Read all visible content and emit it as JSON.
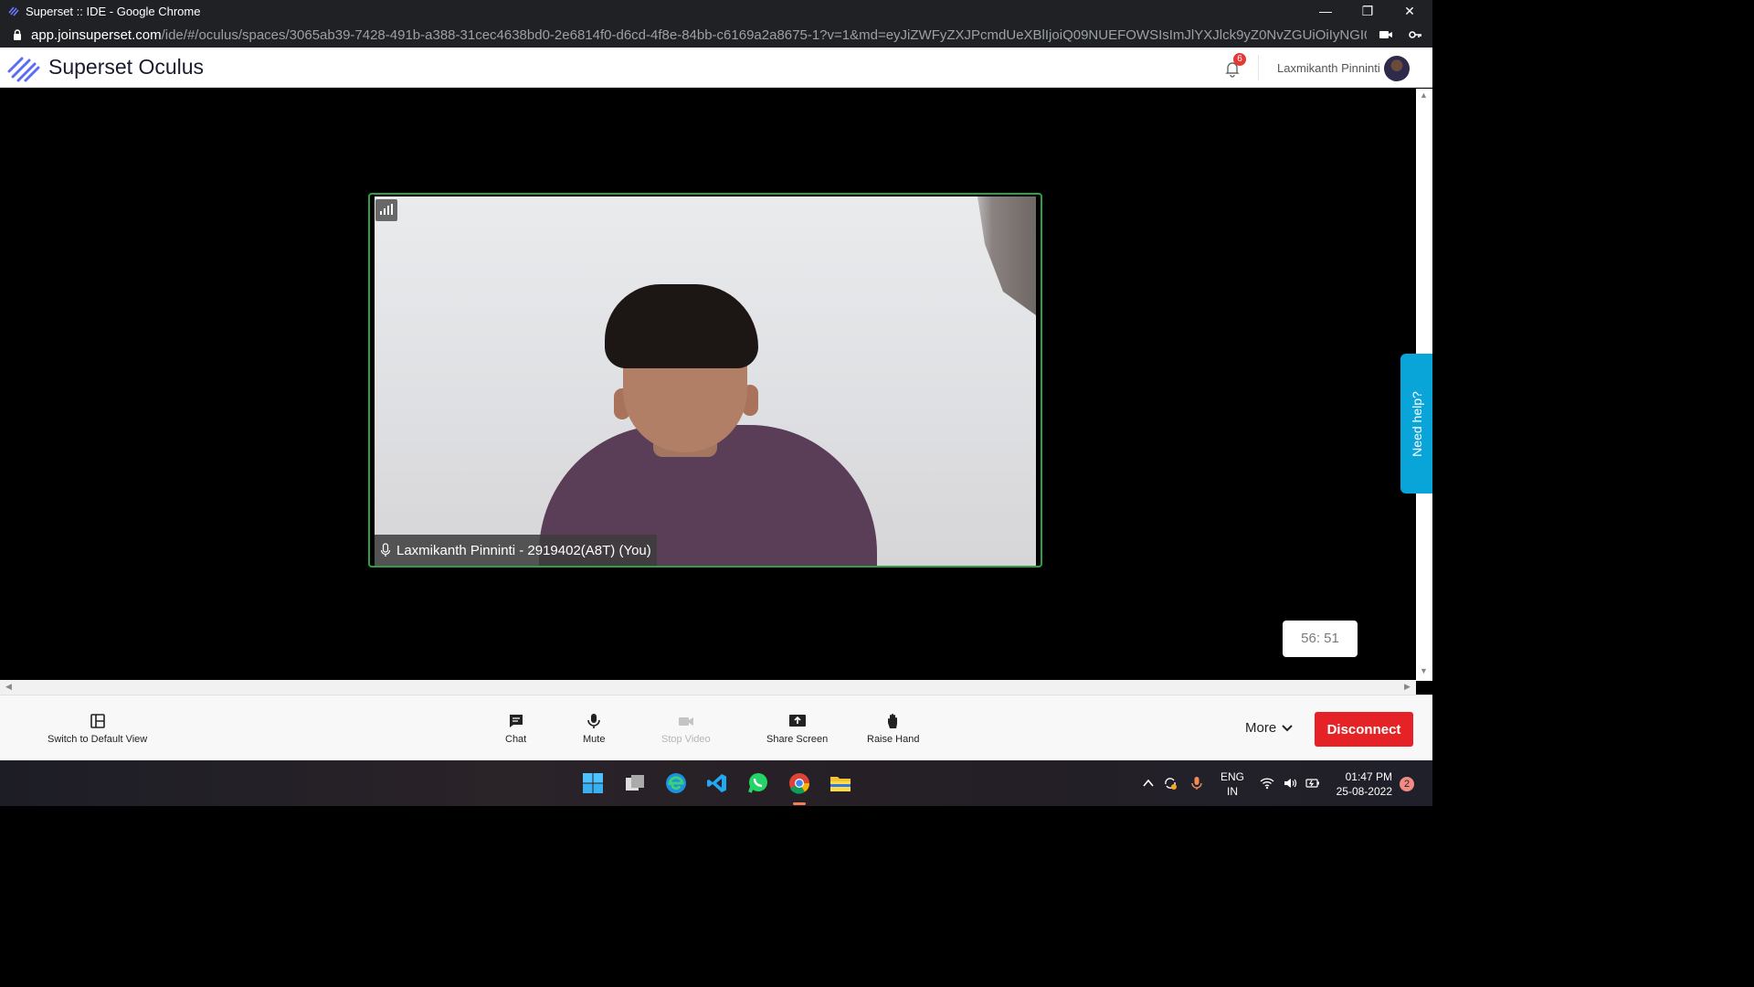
{
  "window": {
    "title": "Superset :: IDE - Google Chrome"
  },
  "addressbar": {
    "host": "app.joinsuperset.com",
    "path": "/ide/#/oculus/spaces/3065ab39-7428-491b-a388-31cec4638bd0-2e6814f0-d6cd-4f8e-84bb-c6169a2a8675-1?v=1&md=eyJiZWFyZXJPcmdUeXBlIjoiQ09NUEFOWSIsImJlYXJlck9yZ0NvZGUiOiIyNGI0NDliNi1kOG..."
  },
  "app": {
    "brand": "Superset Oculus",
    "notification_count": "6",
    "user_name": "Laxmikanth Pinninti"
  },
  "meeting": {
    "participant_label": "Laxmikanth Pinninti - 2919402(A8T) (You)",
    "timer": "56: 51",
    "need_help": "Need help?"
  },
  "controls": {
    "switch_view": "Switch to Default View",
    "chat": "Chat",
    "mute": "Mute",
    "stop_video": "Stop Video",
    "share_screen": "Share Screen",
    "raise_hand": "Raise Hand",
    "more": "More",
    "disconnect": "Disconnect"
  },
  "taskbar": {
    "apps": [
      "start-icon",
      "task-view-icon",
      "edge-icon",
      "vscode-icon",
      "whatsapp-icon",
      "chrome-icon",
      "file-explorer-icon"
    ],
    "lang_top": "ENG",
    "lang_bottom": "IN",
    "time": "01:47 PM",
    "date": "25-08-2022",
    "notification_count": "2"
  },
  "colors": {
    "accent_green": "#2ea043",
    "disconnect_red": "#e52225",
    "need_help_blue": "#0aa5d8"
  }
}
